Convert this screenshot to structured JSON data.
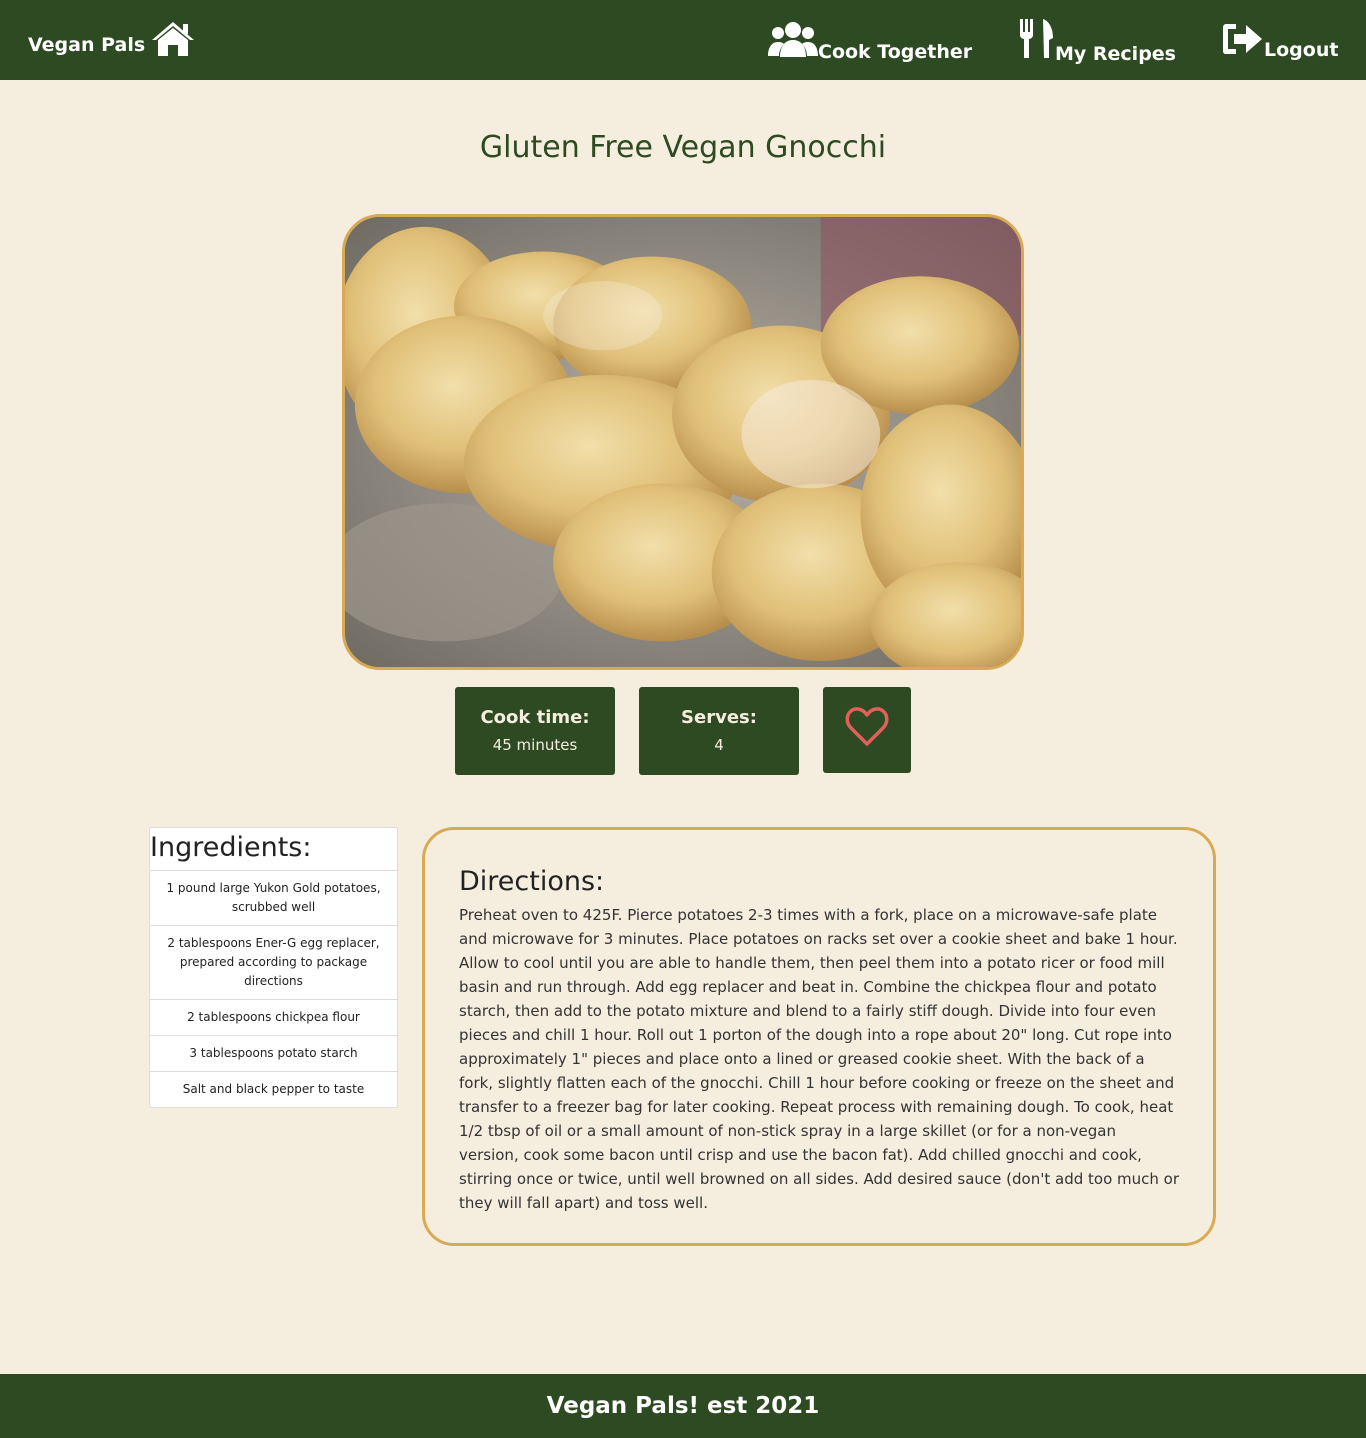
{
  "nav": {
    "brand": "Vegan Pals",
    "links": [
      {
        "label": "Cook Together",
        "icon": "users-icon"
      },
      {
        "label": "My Recipes",
        "icon": "utensils-icon"
      },
      {
        "label": "Logout",
        "icon": "sign-out-icon"
      }
    ],
    "home_icon": "home-icon"
  },
  "recipe": {
    "title": "Gluten Free Vegan Gnocchi",
    "image_alt": "Gnocchi dusted with flour",
    "cook_time_label": "Cook time:",
    "cook_time_value": "45 minutes",
    "serves_label": "Serves:",
    "serves_value": "4",
    "favorite_icon": "heart-outline-icon"
  },
  "ingredients": {
    "heading": "Ingredients:",
    "items": [
      "1 pound large Yukon Gold potatoes, scrubbed well",
      "2 tablespoons Ener-G egg replacer, prepared according to package directions",
      "2 tablespoons chickpea flour",
      "3 tablespoons potato starch",
      "Salt and black pepper to taste"
    ]
  },
  "directions": {
    "heading": "Directions:",
    "text": "Preheat oven to 425F. Pierce potatoes 2-3 times with a fork, place on a microwave-safe plate and microwave for 3 minutes. Place potatoes on racks set over a cookie sheet and bake 1 hour. Allow to cool until you are able to handle them, then peel them into a potato ricer or food mill basin and run through. Add egg replacer and beat in. Combine the chickpea flour and potato starch, then add to the potato mixture and blend to a fairly stiff dough. Divide into four even pieces and chill 1 hour. Roll out 1 porton of the dough into a rope about 20\" long. Cut rope into approximately 1\" pieces and place onto a lined or greased cookie sheet. With the back of a fork, slightly flatten each of the gnocchi. Chill 1 hour before cooking or freeze on the sheet and transfer to a freezer bag for later cooking. Repeat process with remaining dough. To cook, heat 1/2 tbsp of oil or a small amount of non-stick spray in a large skillet (or for a non-vegan version, cook some bacon until crisp and use the bacon fat). Add chilled gnocchi and cook, stirring once or twice, until well browned on all sides. Add desired sauce (don't add too much or they will fall apart) and toss well."
  },
  "footer": {
    "text": "Vegan Pals! est 2021"
  },
  "colors": {
    "primary": "#2d4a22",
    "background": "#f5eedf",
    "accent_border": "#d9aa55",
    "heart": "#e0605a"
  }
}
